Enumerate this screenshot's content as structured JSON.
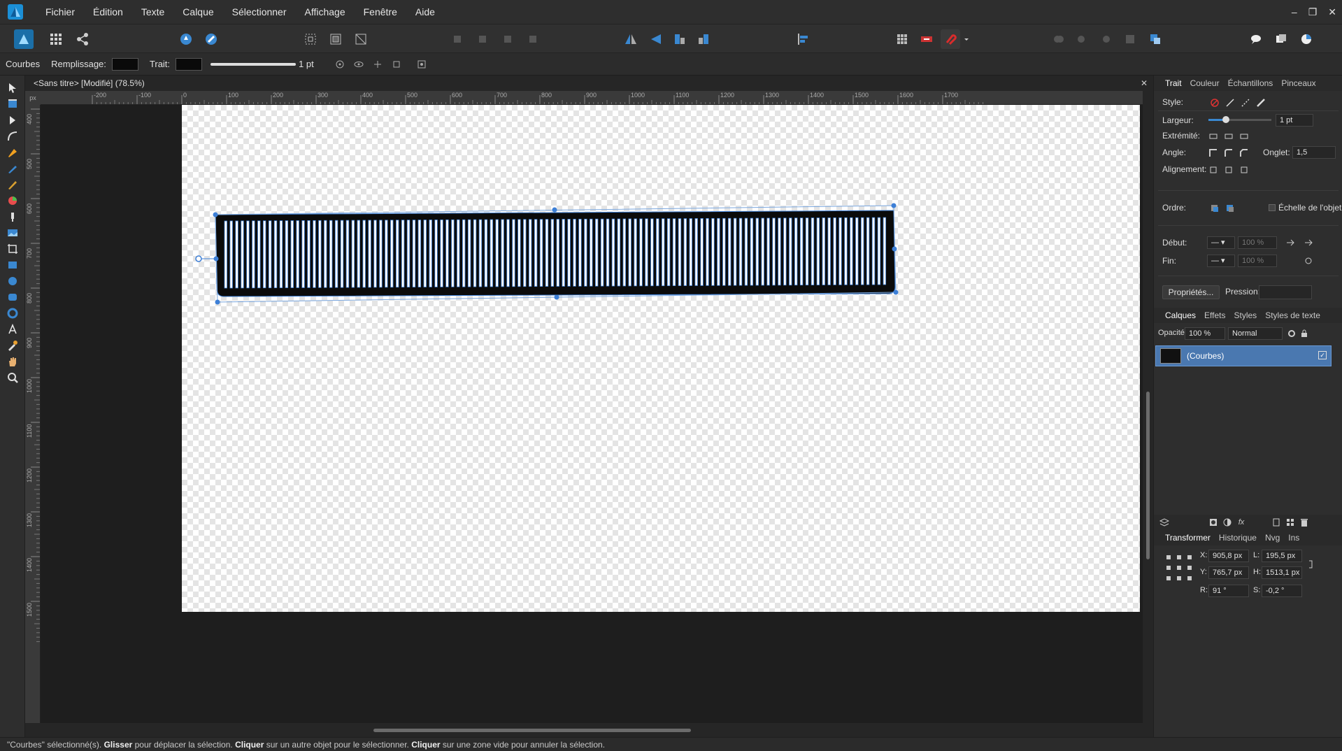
{
  "menu": [
    "Fichier",
    "Édition",
    "Texte",
    "Calque",
    "Sélectionner",
    "Affichage",
    "Fenêtre",
    "Aide"
  ],
  "window_controls": [
    "–",
    "❐",
    "✕"
  ],
  "context": {
    "tool_name": "Courbes",
    "fill_label": "Remplissage:",
    "stroke_label": "Trait:",
    "stroke_width": "1 pt"
  },
  "document": {
    "tab_title": "<Sans titre> [Modifié] (78.5%)",
    "ruler_unit": "px",
    "h_ruler_ticks": [
      "-200",
      "-100",
      "0",
      "100",
      "200",
      "300",
      "400",
      "500",
      "600",
      "700",
      "800",
      "900",
      "1000",
      "1100",
      "1200",
      "1300",
      "1400",
      "1500",
      "1600",
      "1700"
    ],
    "v_ruler_ticks": [
      "400",
      "500",
      "600",
      "700",
      "800",
      "900",
      "1000",
      "1100",
      "1200",
      "1300",
      "1400",
      "1500"
    ]
  },
  "stroke_panel": {
    "tabs": [
      "Trait",
      "Couleur",
      "Échantillons",
      "Pinceaux"
    ],
    "style_label": "Style:",
    "width_label": "Largeur:",
    "width_value": "1 pt",
    "cap_label": "Extrémité:",
    "join_label": "Angle:",
    "miter_label": "Onglet:",
    "miter_value": "1,5",
    "align_label": "Alignement:",
    "order_label": "Ordre:",
    "scale_with_object_label": "Échelle de l'objet",
    "start_label": "Début:",
    "end_label": "Fin:",
    "start_percent": "100 %",
    "end_percent": "100 %",
    "properties_button": "Propriétés...",
    "pressure_label": "Pression:"
  },
  "layers_panel": {
    "tabs": [
      "Calques",
      "Effets",
      "Styles",
      "Styles de texte"
    ],
    "opacity_label": "Opacité:",
    "opacity_value": "100 %",
    "blend_mode": "Normal",
    "layers": [
      {
        "name": "(Courbes)"
      }
    ]
  },
  "transform_panel": {
    "tabs": [
      "Transformer",
      "Historique",
      "Nvg",
      "Ins"
    ],
    "x_label": "X:",
    "x_value": "905,8 px",
    "y_label": "Y:",
    "y_value": "765,7 px",
    "w_label": "L:",
    "w_value": "195,5 px",
    "h_label": "H:",
    "h_value": "1513,1 px",
    "r_label": "R:",
    "r_value": "91 °",
    "s_label": "S:",
    "s_value": "-0,2 °"
  },
  "status": {
    "part1": "\"Courbes\" sélectionné(s). ",
    "b1": "Glisser",
    "part2": " pour déplacer la sélection. ",
    "b2": "Cliquer",
    "part3": " sur un autre objet pour le sélectionner. ",
    "b3": "Cliquer",
    "part4": " sur une zone vide pour annuler la sélection."
  },
  "colors": {
    "accent": "#4a78b0",
    "selection": "#3d7fd6",
    "shape_fill": "#0b0b0b"
  }
}
